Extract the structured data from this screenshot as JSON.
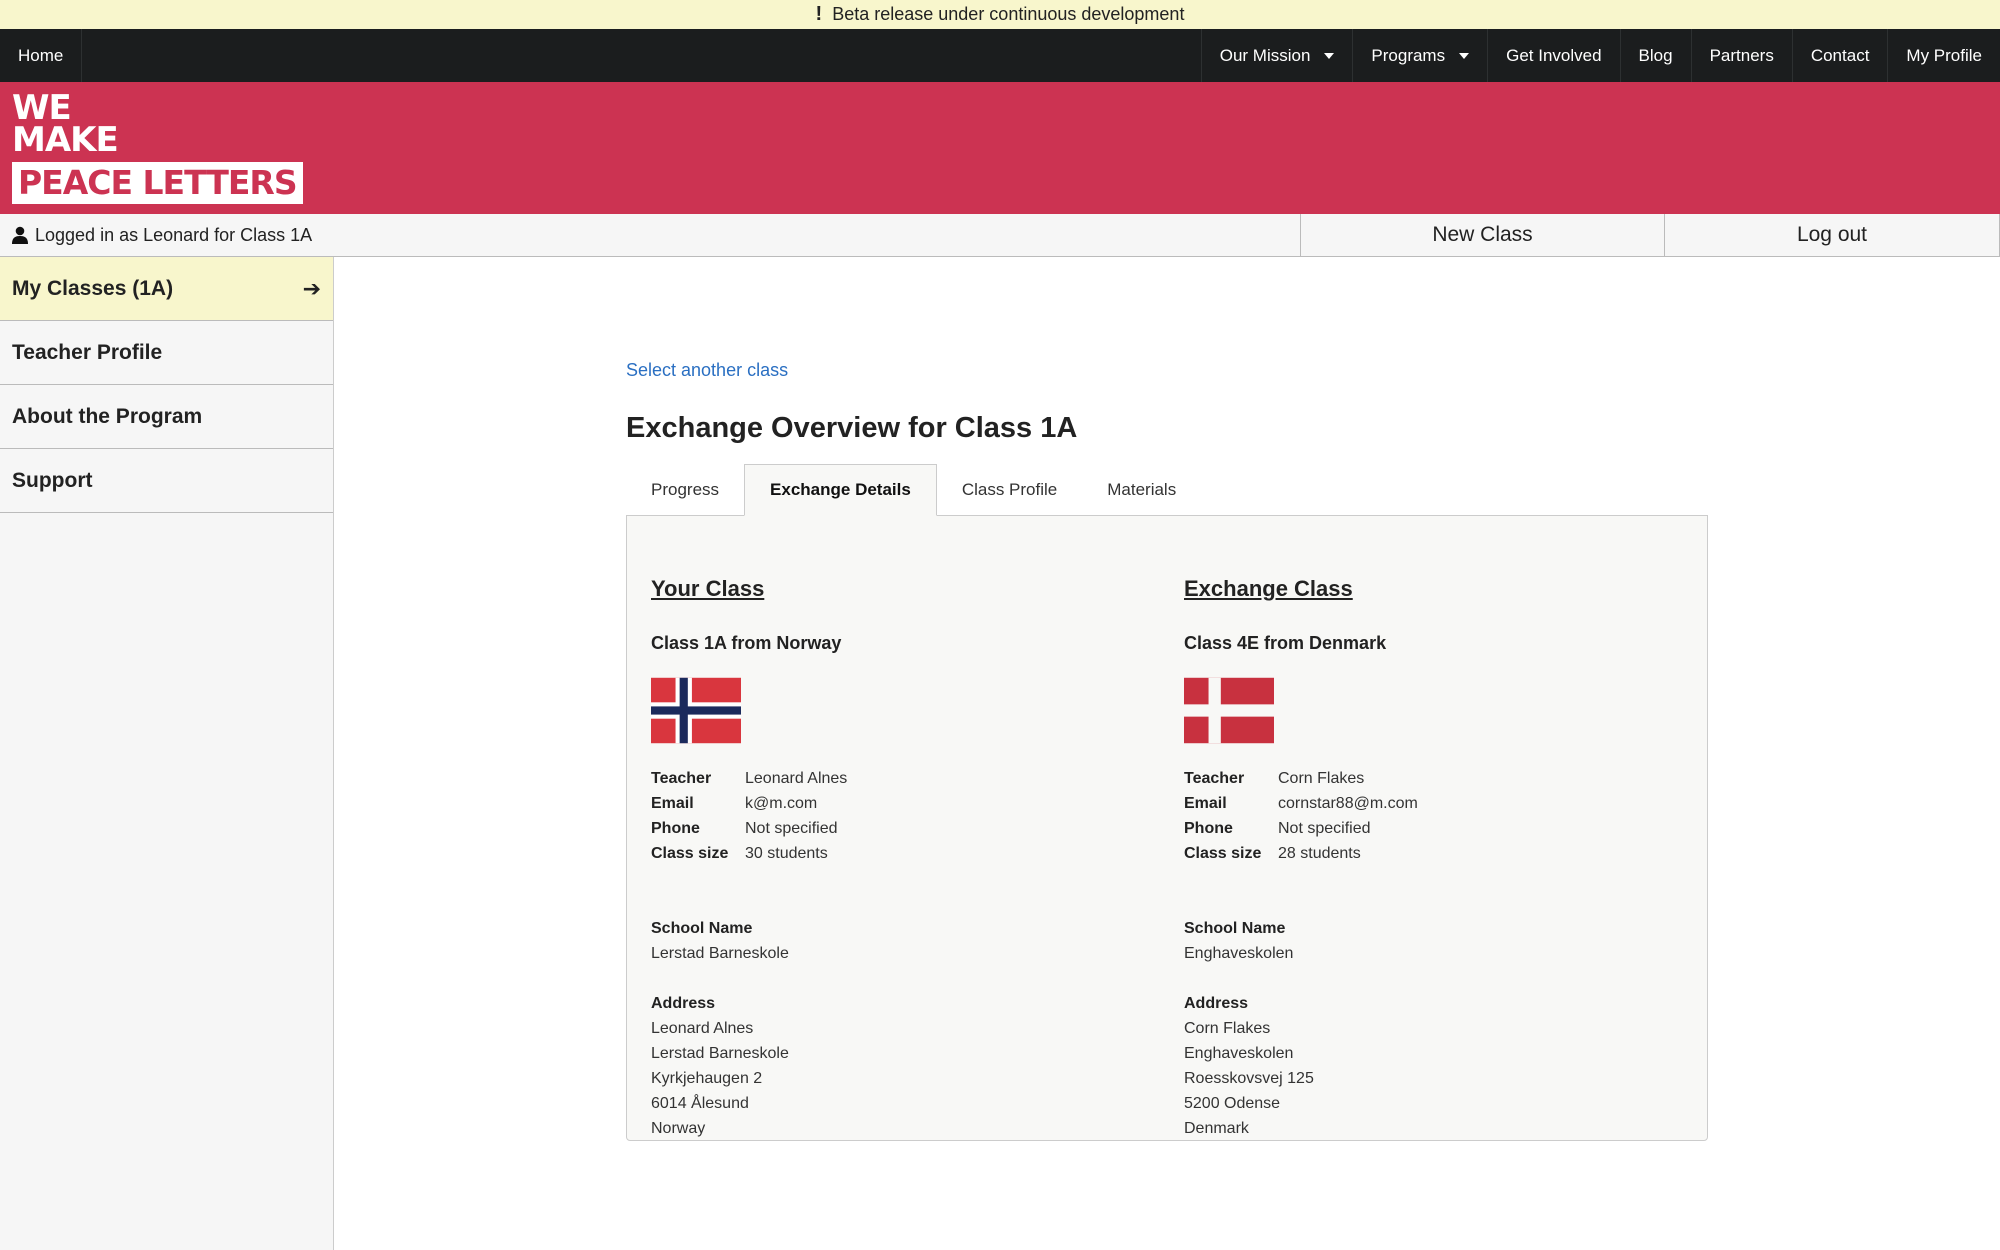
{
  "banner": {
    "text": "Beta release under continuous development"
  },
  "nav": {
    "home": "Home",
    "items": [
      "Our Mission",
      "Programs",
      "Get Involved",
      "Blog",
      "Partners",
      "Contact",
      "My Profile"
    ]
  },
  "logo": {
    "line1": "WE",
    "line2": "MAKE",
    "line3": "PEACE LETTERS"
  },
  "userbar": {
    "logged_in": "Logged in as Leonard for Class 1A",
    "new_class": "New Class",
    "log_out": "Log out"
  },
  "sidebar": {
    "items": [
      {
        "label": "My Classes (1A)"
      },
      {
        "label": "Teacher Profile"
      },
      {
        "label": "About the Program"
      },
      {
        "label": "Support"
      }
    ]
  },
  "main": {
    "select_link": "Select another class",
    "title": "Exchange Overview for Class 1A",
    "tabs": [
      "Progress",
      "Exchange Details",
      "Class Profile",
      "Materials"
    ],
    "active_tab": "Exchange Details"
  },
  "labels": {
    "teacher": "Teacher",
    "email": "Email",
    "phone": "Phone",
    "class_size": "Class size",
    "school_name": "School Name",
    "address": "Address"
  },
  "your_class": {
    "heading": "Your Class",
    "from": "Class 1A from Norway",
    "flag": "norway-flag",
    "teacher": "Leonard Alnes",
    "email": "k@m.com",
    "phone": "Not specified",
    "class_size": "30 students",
    "school_name": "Lerstad Barneskole",
    "address": [
      "Leonard Alnes",
      "Lerstad Barneskole",
      "Kyrkjehaugen 2",
      "6014 Ålesund",
      "Norway"
    ]
  },
  "exchange_class": {
    "heading": "Exchange Class",
    "from": "Class 4E from Denmark",
    "flag": "denmark-flag",
    "teacher": "Corn Flakes",
    "email": "cornstar88@m.com",
    "phone": "Not specified",
    "class_size": "28 students",
    "school_name": "Enghaveskolen",
    "address": [
      "Corn Flakes",
      "Enghaveskolen",
      "Roesskovsvej 125",
      "5200 Odense",
      "Denmark"
    ]
  },
  "colors": {
    "brand": "#cc3352",
    "banner": "#f8f6cc",
    "nav": "#1b1d1e",
    "link": "#2a6fc2"
  }
}
